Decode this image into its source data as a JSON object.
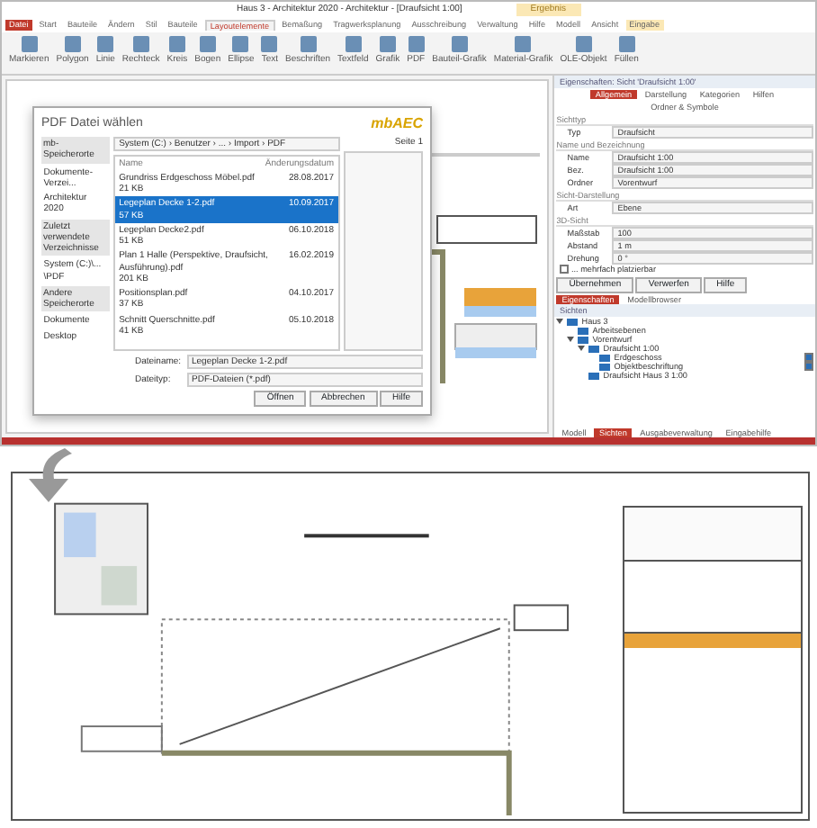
{
  "window": {
    "title": "Haus 3 - Architektur 2020 - Architektur - [Draufsicht 1:00]",
    "context_tab": "Ergebnis"
  },
  "ribbon_tabs": [
    {
      "label": "Datei",
      "selected": false,
      "kind": "file"
    },
    {
      "label": "Start",
      "selected": false,
      "kind": "tab"
    },
    {
      "label": "Bauteile",
      "selected": false,
      "kind": "tab"
    },
    {
      "label": "Ändern",
      "selected": false,
      "kind": "tab"
    },
    {
      "label": "Stil",
      "selected": false,
      "kind": "tab"
    },
    {
      "label": "Bauteile",
      "selected": false,
      "kind": "tab"
    },
    {
      "label": "Layoutelemente",
      "selected": true,
      "kind": "tab"
    },
    {
      "label": "Bemaßung",
      "selected": false,
      "kind": "tab"
    },
    {
      "label": "Tragwerksplanung",
      "selected": false,
      "kind": "tab"
    },
    {
      "label": "Ausschreibung",
      "selected": false,
      "kind": "tab"
    },
    {
      "label": "Verwaltung",
      "selected": false,
      "kind": "tab"
    },
    {
      "label": "Hilfe",
      "selected": false,
      "kind": "tab"
    },
    {
      "label": "Modell",
      "selected": false,
      "kind": "tab"
    },
    {
      "label": "Ansicht",
      "selected": false,
      "kind": "tab"
    },
    {
      "label": "Eingabe",
      "selected": false,
      "kind": "context"
    }
  ],
  "ribbon_buttons": [
    "Markieren",
    "Polygon",
    "Linie",
    "Rechteck",
    "Kreis",
    "Bogen",
    "Ellipse",
    "Text",
    "Beschriften",
    "Textfeld",
    "Grafik",
    "PDF",
    "Bauteil-Grafik",
    "Material-Grafik",
    "OLE-Objekt",
    "Füllen"
  ],
  "dialog": {
    "title": "PDF Datei wählen",
    "logo": "mbAEC",
    "path": "System (C:) › Benutzer › ... › Import › PDF",
    "sections": [
      {
        "heading": "mb-Speicherorte",
        "items": [
          "Dokumente-Verzei...",
          "Architektur 2020"
        ]
      },
      {
        "heading": "Zuletzt verwendete Verzeichnisse",
        "items": [
          "System (C:)\\... \\PDF"
        ]
      },
      {
        "heading": "Andere Speicherorte",
        "items": [
          "Dokumente",
          "Desktop"
        ]
      }
    ],
    "columns": [
      "Name",
      "Änderungsdatum"
    ],
    "files": [
      {
        "name": "Grundriss Erdgeschoss Möbel.pdf",
        "size": "21 KB",
        "date": "28.08.2017",
        "selected": false
      },
      {
        "name": "Legeplan Decke 1-2.pdf",
        "size": "57 KB",
        "date": "10.09.2017",
        "selected": true
      },
      {
        "name": "Legeplan Decke2.pdf",
        "size": "51 KB",
        "date": "06.10.2018",
        "selected": false
      },
      {
        "name": "Plan 1 Halle (Perspektive, Draufsicht, Ausführung).pdf",
        "size": "201 KB",
        "date": "16.02.2019",
        "selected": false
      },
      {
        "name": "Positionsplan.pdf",
        "size": "37 KB",
        "date": "04.10.2017",
        "selected": false
      },
      {
        "name": "Schnitt Querschnitte.pdf",
        "size": "41 KB",
        "date": "05.10.2018",
        "selected": false
      }
    ],
    "filename_label": "Dateiname:",
    "filename": "Legeplan Decke 1-2.pdf",
    "filetype_label": "Dateityp:",
    "filetype": "PDF-Dateien (*.pdf)",
    "page": "Seite 1",
    "buttons": [
      "Öffnen",
      "Abbrechen",
      "Hilfe"
    ]
  },
  "properties": {
    "title": "Eigenschaften: Sicht 'Draufsicht 1:00'",
    "tabs": [
      {
        "label": "Allgemein",
        "selected": true
      },
      {
        "label": "Darstellung",
        "selected": false
      },
      {
        "label": "Kategorien",
        "selected": false
      },
      {
        "label": "Hilfen",
        "selected": false
      },
      {
        "label": "Ordner & Symbole",
        "selected": false
      }
    ],
    "groups": [
      {
        "heading": "Sichttyp",
        "fields": [
          {
            "label": "Typ",
            "value": "Draufsicht"
          }
        ]
      },
      {
        "heading": "Name und Bezeichnung",
        "fields": [
          {
            "label": "Name",
            "value": "Draufsicht 1:00"
          },
          {
            "label": "Bez.",
            "value": "Draufsicht 1:00"
          },
          {
            "label": "Ordner",
            "value": "Vorentwurf"
          }
        ]
      },
      {
        "heading": "Sicht-Darstellung",
        "fields": [
          {
            "label": "Art",
            "value": "Ebene"
          }
        ]
      },
      {
        "heading": "3D-Sicht",
        "fields": [
          {
            "label": "Maßstab",
            "value": "100"
          },
          {
            "label": "Abstand",
            "value": "1 m"
          },
          {
            "label": "Drehung",
            "value": "0 °"
          }
        ]
      }
    ],
    "checkbox": {
      "label": "... mehrfach platzierbar",
      "checked": false
    },
    "actions": [
      "Übernehmen",
      "Verwerfen",
      "Hilfe"
    ]
  },
  "browser": {
    "tabs": [
      {
        "label": "Eigenschaften",
        "selected": true
      },
      {
        "label": "Modellbrowser",
        "selected": false
      }
    ],
    "heading": "Sichten",
    "tree": [
      {
        "label": "Haus 3",
        "expanded": true,
        "children": [
          {
            "label": "Arbeitsebenen"
          },
          {
            "label": "Vorentwurf",
            "expanded": true,
            "children": [
              {
                "label": "Draufsicht 1:00",
                "expanded": true,
                "children": [
                  {
                    "label": "Erdgeschoss",
                    "visible": true
                  },
                  {
                    "label": "Objektbeschriftung",
                    "visible": true
                  }
                ]
              },
              {
                "label": "Draufsicht Haus 3 1:00"
              }
            ]
          }
        ]
      }
    ],
    "bottom_tabs": [
      {
        "label": "Modell",
        "selected": false
      },
      {
        "label": "Sichten",
        "selected": true
      },
      {
        "label": "Ausgabeverwaltung",
        "selected": false
      },
      {
        "label": "Eingabehilfe",
        "selected": false
      }
    ]
  }
}
